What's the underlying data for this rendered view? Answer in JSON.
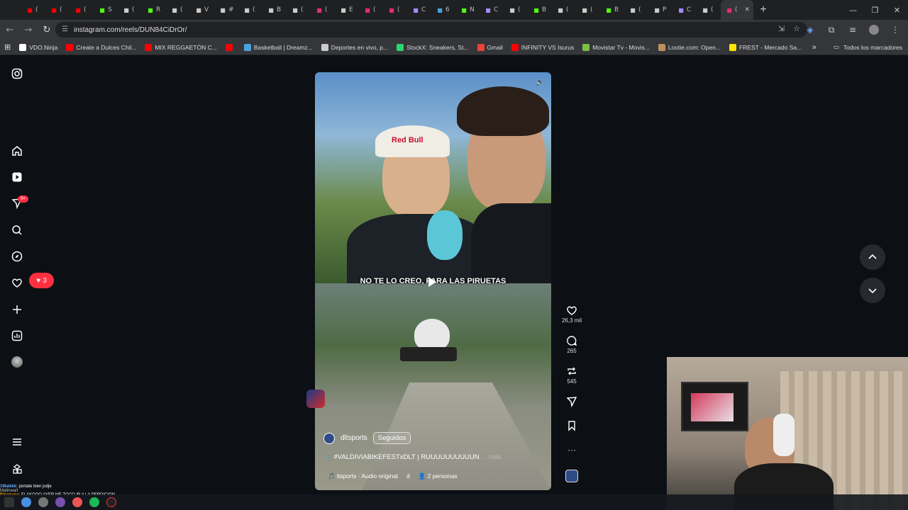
{
  "browser": {
    "tabs": [
      {
        "icon": "youtube-icon",
        "label": "(",
        "color": "#ff0000"
      },
      {
        "icon": "youtube-icon",
        "label": "(",
        "color": "#ff0000"
      },
      {
        "icon": "youtube-icon",
        "label": "(",
        "color": "#ff0000"
      },
      {
        "icon": "kick-icon",
        "label": "S",
        "color": "#53fc18"
      },
      {
        "icon": "x-icon",
        "label": "(",
        "color": "#cccccc"
      },
      {
        "icon": "kick-icon",
        "label": "R",
        "color": "#53fc18"
      },
      {
        "icon": "tiktok-icon",
        "label": "(",
        "color": "#cccccc"
      },
      {
        "icon": "tiktok-icon",
        "label": "V",
        "color": "#cccccc"
      },
      {
        "icon": "tiktok-icon",
        "label": "#",
        "color": "#cccccc"
      },
      {
        "icon": "tiktok-icon",
        "label": "(",
        "color": "#cccccc"
      },
      {
        "icon": "tiktok-icon",
        "label": "B",
        "color": "#cccccc"
      },
      {
        "icon": "tiktok-icon",
        "label": "(",
        "color": "#cccccc"
      },
      {
        "icon": "instagram-icon",
        "label": "(",
        "color": "#e1306c"
      },
      {
        "icon": "tiktok-icon",
        "label": "E",
        "color": "#cccccc"
      },
      {
        "icon": "instagram-icon",
        "label": "(",
        "color": "#e1306c"
      },
      {
        "icon": "instagram-icon",
        "label": "(",
        "color": "#e1306c"
      },
      {
        "icon": "pen-icon",
        "label": "C",
        "color": "#a78bfa"
      },
      {
        "icon": "stat-icon",
        "label": "6",
        "color": "#4aa3df"
      },
      {
        "icon": "kick-icon",
        "label": "N",
        "color": "#53fc18"
      },
      {
        "icon": "pen-icon",
        "label": "C",
        "color": "#a78bfa"
      },
      {
        "icon": "tiktok-icon",
        "label": "(",
        "color": "#cccccc"
      },
      {
        "icon": "kick-icon",
        "label": "B",
        "color": "#53fc18"
      },
      {
        "icon": "tiktok-icon",
        "label": "(",
        "color": "#cccccc"
      },
      {
        "icon": "tiktok-icon",
        "label": "(",
        "color": "#cccccc"
      },
      {
        "icon": "kick-icon",
        "label": "B",
        "color": "#53fc18"
      },
      {
        "icon": "x-icon",
        "label": "(",
        "color": "#cccccc"
      },
      {
        "icon": "tiktok-icon",
        "label": "P",
        "color": "#cccccc"
      },
      {
        "icon": "pen-icon",
        "label": "C",
        "color": "#a78bfa"
      },
      {
        "icon": "tiktok-icon",
        "label": "(",
        "color": "#cccccc"
      },
      {
        "icon": "instagram-icon",
        "label": "(",
        "color": "#e1306c",
        "active": true
      }
    ],
    "url": "instagram.com/reels/DUN84CiDrOr/",
    "bookmarks": [
      {
        "label": "VDO.Ninja",
        "color": "#ffffff"
      },
      {
        "label": "Create a Dulces Chil...",
        "color": "#ff0000"
      },
      {
        "label": "MIX REGGAETÓN C...",
        "color": "#ff0000"
      },
      {
        "label": "",
        "color": "#ff0000"
      },
      {
        "label": "Basketball | Dreamz...",
        "color": "#4aa3df"
      },
      {
        "label": "Deportes en vivo, p...",
        "color": "#cccccc"
      },
      {
        "label": "StockX: Sneakers, St...",
        "color": "#2bd66e"
      },
      {
        "label": "Gmail",
        "color": "#ea4335"
      },
      {
        "label": "INFINITY VS Isurus",
        "color": "#ff0000"
      },
      {
        "label": "Movistar Tv - Movis...",
        "color": "#7ac143"
      },
      {
        "label": "Lootie.com: Open...",
        "color": "#c09060"
      },
      {
        "label": "FREST - Mercado Sa...",
        "color": "#ffe600"
      }
    ],
    "bookmarks_more": "»",
    "all_bookmarks": "Todos los marcadores"
  },
  "sidebar": {
    "notifications_badge": "9+",
    "activity_count": "3"
  },
  "reel": {
    "subtitle": "NO TE LO CREO, PARA LAS PIRUETAS",
    "username": "dltsports",
    "follow_label": "Seguidos",
    "caption": "🚲 #VALDIVIABIKEFESTxDLT | RUUUUUUUUUUN",
    "caption_more": "... más",
    "audio": "🎵 ltsports · Audio original",
    "audio_sep": "d",
    "people": "👤 2 personas"
  },
  "actions": {
    "likes": "26,3 mil",
    "comments": "265",
    "reposts": "545"
  },
  "overlay": {
    "chat_line1_user": "1Maikkk",
    "chat_line1_msg": ": portate bien jodje",
    "chat_line2_user": "Malinwart",
    "chat_line2_msg": "",
    "chat_line3_user": "Elpanana",
    "chat_line3_msg": ": FLAKOOO AYER ME TOCO IR A LA PERDICION"
  },
  "colors": {
    "page_bg": "#0c1014",
    "accent_red": "#ff3040",
    "chrome_bg": "#35363a"
  }
}
